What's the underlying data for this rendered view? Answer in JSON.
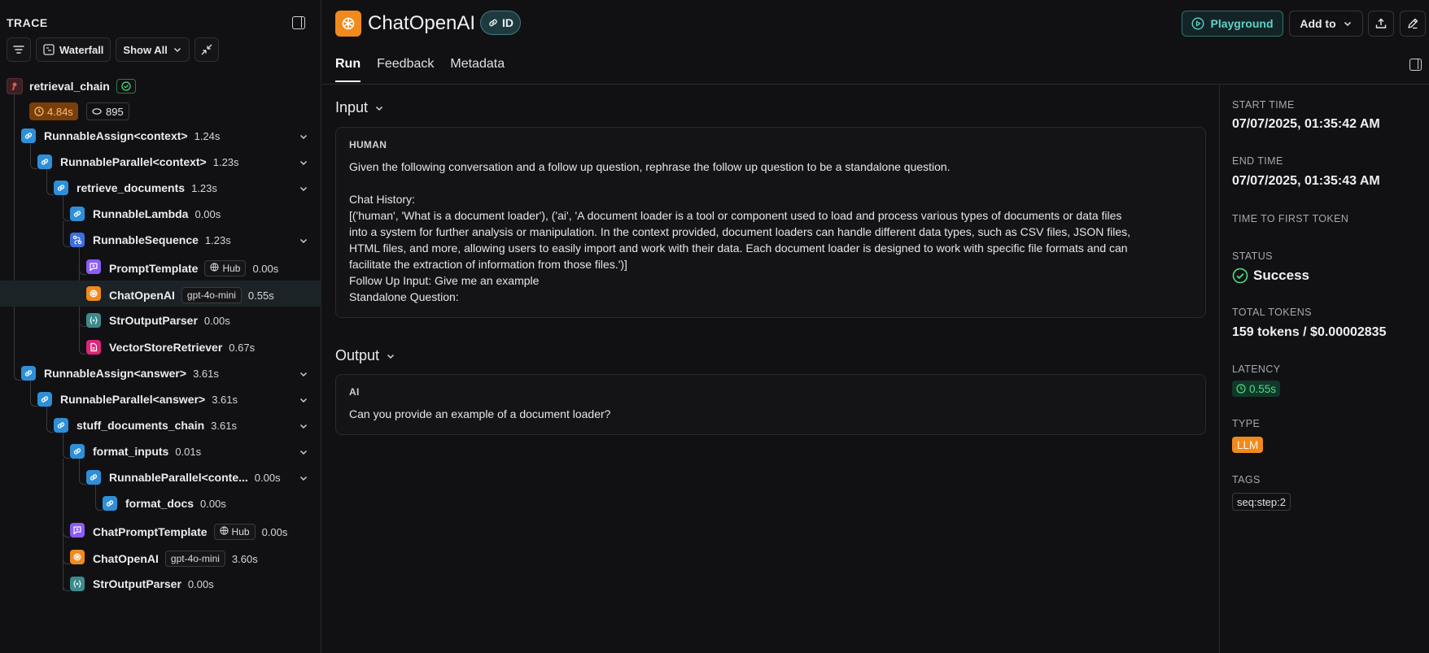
{
  "trace_panel": {
    "title": "TRACE",
    "toolbar": {
      "waterfall_label": "Waterfall",
      "show_all_label": "Show All"
    },
    "root": {
      "name": "retrieval_chain",
      "latency": "4.84s",
      "tokens": "895"
    },
    "rows": [
      {
        "name": "RunnableAssign<context>",
        "latency": "1.24s",
        "icon": "link-icon",
        "color": "#2e8fd8"
      },
      {
        "name": "RunnableParallel<context>",
        "latency": "1.23s",
        "icon": "link-icon",
        "color": "#2e8fd8"
      },
      {
        "name": "retrieve_documents",
        "latency": "1.23s",
        "icon": "link-icon",
        "color": "#2e8fd8"
      },
      {
        "name": "RunnableLambda",
        "latency": "0.00s",
        "icon": "link-icon",
        "color": "#2e8fd8"
      },
      {
        "name": "RunnableSequence",
        "latency": "1.23s",
        "icon": "sequence-icon",
        "color": "#3d6fe0"
      },
      {
        "name": "PromptTemplate",
        "latency": "0.00s",
        "chip": "Hub",
        "icon": "prompt-icon",
        "color": "#8b5cf6"
      },
      {
        "name": "ChatOpenAI",
        "latency": "0.55s",
        "chip": "gpt-4o-mini",
        "icon": "openai-icon",
        "color": "#f08a1c"
      },
      {
        "name": "StrOutputParser",
        "latency": "0.00s",
        "icon": "parser-icon",
        "color": "#3c8b8c"
      },
      {
        "name": "VectorStoreRetriever",
        "latency": "0.67s",
        "icon": "document-icon",
        "color": "#db2777"
      },
      {
        "name": "RunnableAssign<answer>",
        "latency": "3.61s",
        "icon": "link-icon",
        "color": "#2e8fd8"
      },
      {
        "name": "RunnableParallel<answer>",
        "latency": "3.61s",
        "icon": "link-icon",
        "color": "#2e8fd8"
      },
      {
        "name": "stuff_documents_chain",
        "latency": "3.61s",
        "icon": "link-icon",
        "color": "#2e8fd8"
      },
      {
        "name": "format_inputs",
        "latency": "0.01s",
        "icon": "link-icon",
        "color": "#2e8fd8"
      },
      {
        "name": "RunnableParallel<conte...",
        "latency": "0.00s",
        "icon": "link-icon",
        "color": "#2e8fd8"
      },
      {
        "name": "format_docs",
        "latency": "0.00s",
        "icon": "link-icon",
        "color": "#2e8fd8"
      },
      {
        "name": "ChatPromptTemplate",
        "latency": "0.00s",
        "chip": "Hub",
        "icon": "prompt-icon",
        "color": "#8b5cf6"
      },
      {
        "name": "ChatOpenAI",
        "latency": "3.60s",
        "chip": "gpt-4o-mini",
        "icon": "openai-icon",
        "color": "#f08a1c"
      },
      {
        "name": "StrOutputParser",
        "latency": "0.00s",
        "icon": "parser-icon",
        "color": "#3c8b8c"
      }
    ]
  },
  "header": {
    "title": "ChatOpenAI",
    "id_label": "ID",
    "playground_label": "Playground",
    "add_to_label": "Add to"
  },
  "tabs": [
    "Run",
    "Feedback",
    "Metadata"
  ],
  "input": {
    "title": "Input",
    "role": "HUMAN",
    "text": "Given the following conversation and a follow up question, rephrase the follow up question to be a standalone question.\n\nChat History:\n[('human', 'What is a document loader'), ('ai', 'A document loader is a tool or component used to load and process various types of documents or data files\ninto a system for further analysis or manipulation. In the context provided, document loaders can handle different data types, such as CSV files, JSON files,\nHTML files, and more, allowing users to easily import and work with their data. Each document loader is designed to work with specific file formats and can\nfacilitate the extraction of information from those files.')]\nFollow Up Input: Give me an example\nStandalone Question:"
  },
  "output": {
    "title": "Output",
    "role": "AI",
    "text": "Can you provide an example of a document loader?"
  },
  "meta": {
    "start_time_label": "START TIME",
    "start_time": "07/07/2025, 01:35:42 AM",
    "end_time_label": "END TIME",
    "end_time": "07/07/2025, 01:35:43 AM",
    "ttft_label": "TIME TO FIRST TOKEN",
    "status_label": "STATUS",
    "status": "Success",
    "total_tokens_label": "TOTAL TOKENS",
    "total_tokens": "159 tokens / $0.00002835",
    "latency_label": "LATENCY",
    "latency": "0.55s",
    "type_label": "TYPE",
    "type": "LLM",
    "tags_label": "TAGS",
    "tag": "seq:step:2"
  }
}
